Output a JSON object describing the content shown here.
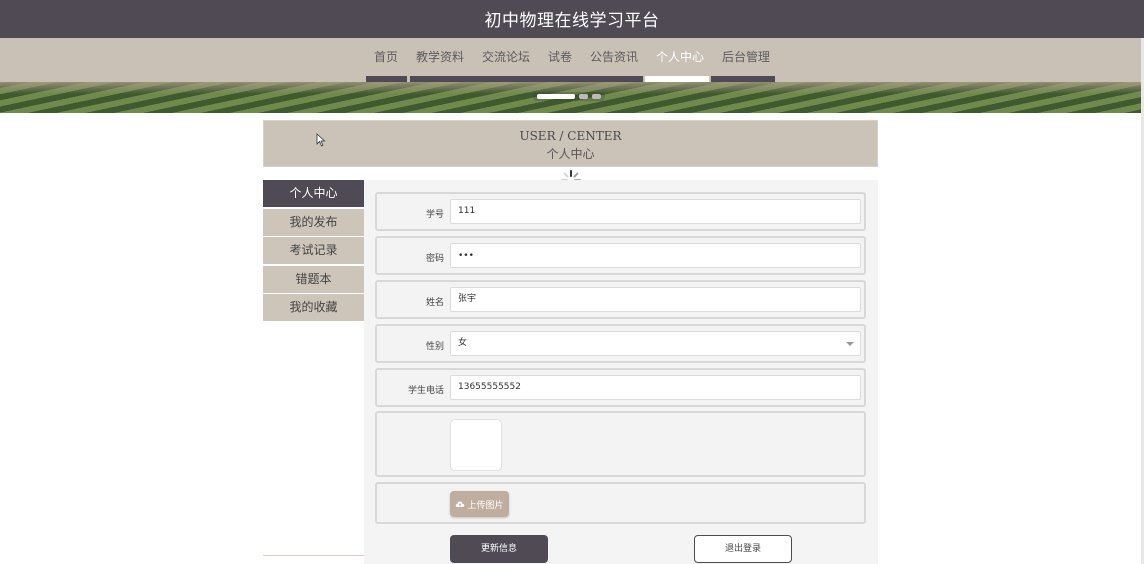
{
  "site": {
    "title": "初中物理在线学习平台"
  },
  "nav": {
    "items": [
      {
        "label": "首页"
      },
      {
        "label": "教学资料"
      },
      {
        "label": "交流论坛"
      },
      {
        "label": "试卷"
      },
      {
        "label": "公告资讯"
      },
      {
        "label": "个人中心",
        "active": true
      },
      {
        "label": "后台管理"
      }
    ]
  },
  "banner": {
    "slide_count": 3,
    "active_slide": 1
  },
  "section": {
    "title_en": "USER / CENTER",
    "title_cn": "个人中心"
  },
  "sidebar": {
    "items": [
      {
        "label": "个人中心",
        "active": true
      },
      {
        "label": "我的发布"
      },
      {
        "label": "考试记录"
      },
      {
        "label": "错题本"
      },
      {
        "label": "我的收藏"
      }
    ]
  },
  "form": {
    "student_id": {
      "label": "学号",
      "value": "111"
    },
    "password": {
      "label": "密码",
      "value": "111"
    },
    "name": {
      "label": "姓名",
      "value": "张宇"
    },
    "gender": {
      "label": "性别",
      "value": "女"
    },
    "phone": {
      "label": "学生电话",
      "value": "13655555552"
    },
    "upload_label": "上传图片"
  },
  "actions": {
    "update_label": "更新信息",
    "logout_label": "退出登录"
  },
  "colors": {
    "primary": "#4f4a54",
    "accent": "#c9c0b6",
    "upload": "#bfae9f"
  }
}
